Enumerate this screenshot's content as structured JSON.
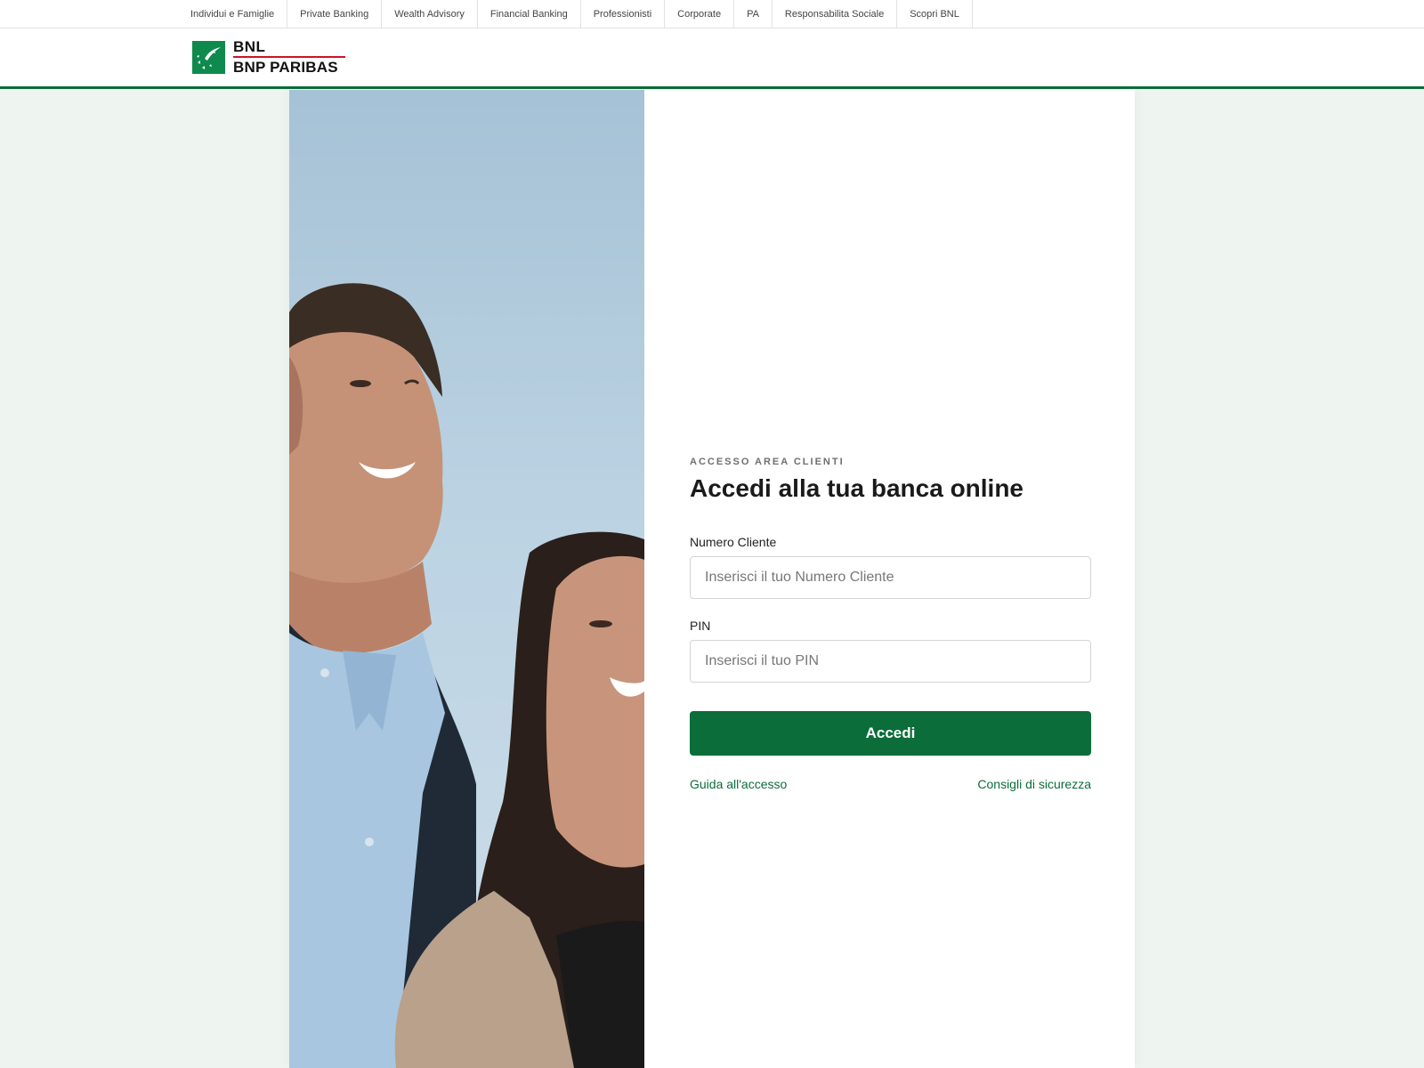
{
  "topnav": {
    "items": [
      {
        "label": "Individui e Famiglie"
      },
      {
        "label": "Private Banking"
      },
      {
        "label": "Wealth Advisory"
      },
      {
        "label": "Financial Banking"
      },
      {
        "label": "Professionisti"
      },
      {
        "label": "Corporate"
      },
      {
        "label": "PA"
      },
      {
        "label": "Responsabilita Sociale"
      },
      {
        "label": "Scopri BNL"
      }
    ]
  },
  "brand": {
    "line1": "BNL",
    "line2": "BNP PARIBAS",
    "colors": {
      "green": "#0e8a4d",
      "accent_red": "#d0112b",
      "dark_green": "#0b6d3a"
    }
  },
  "login": {
    "eyebrow": "ACCESSO AREA CLIENTI",
    "title": "Accedi alla tua banca online",
    "client_number": {
      "label": "Numero Cliente",
      "value": "",
      "placeholder": "Inserisci il tuo Numero Cliente"
    },
    "pin": {
      "label": "PIN",
      "value": "",
      "placeholder": "Inserisci il tuo PIN"
    },
    "submit_label": "Accedi",
    "help_link": "Guida all'accesso",
    "security_link": "Consigli di sicurezza"
  },
  "theme": {
    "page_background": "#eef5f0",
    "primary_button": "#0b6d3a",
    "link_color": "#0b6d3a"
  }
}
